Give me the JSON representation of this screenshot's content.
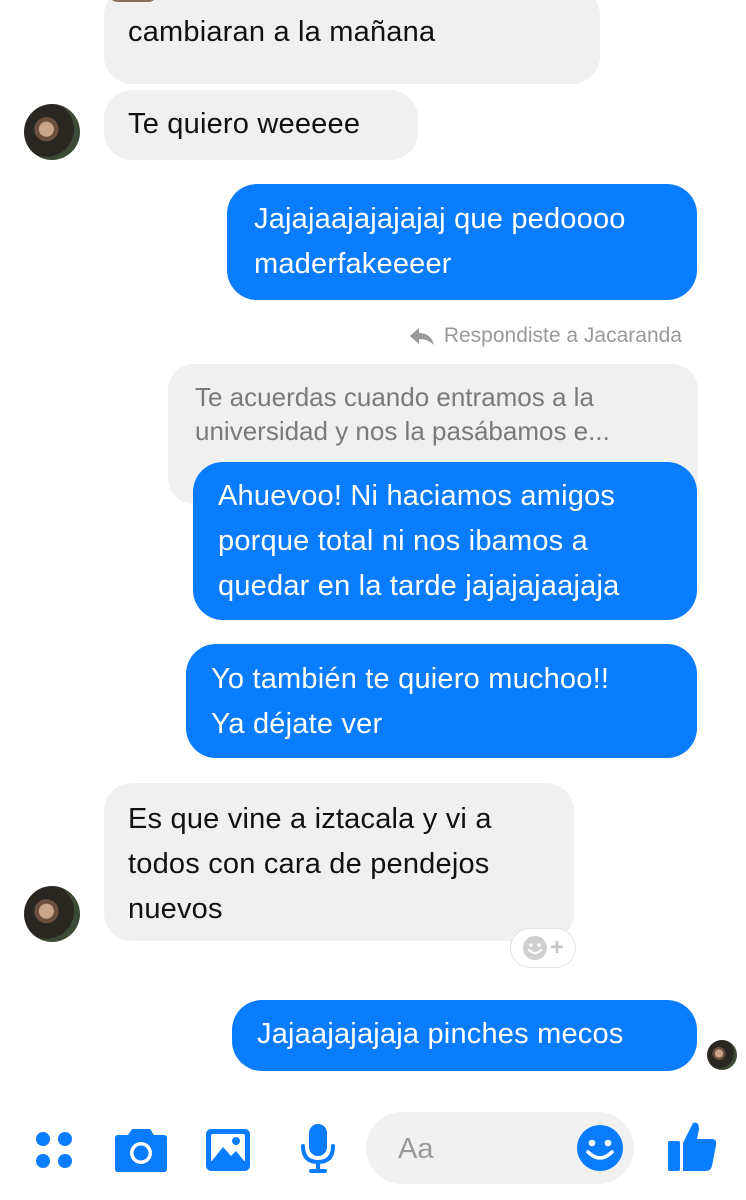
{
  "messages": [
    {
      "id": "m1",
      "direction": "incoming",
      "lines": [
        "cambiaran a la mañana"
      ]
    },
    {
      "id": "m2",
      "direction": "incoming",
      "lines": [
        "Te quiero weeeee"
      ]
    },
    {
      "id": "m3",
      "direction": "outgoing",
      "lines": [
        "Jajajaajajajajaj que pedoooo",
        "maderfakeeeer"
      ]
    },
    {
      "id": "m4",
      "direction": "outgoing",
      "lines": [
        "Ahuevoo! Ni haciamos amigos",
        "porque total ni nos ibamos a",
        "quedar en la tarde jajajajaajaja"
      ]
    },
    {
      "id": "m5",
      "direction": "outgoing",
      "lines": [
        "Yo también te quiero muchoo!!",
        "Ya déjate ver"
      ]
    },
    {
      "id": "m6",
      "direction": "incoming",
      "lines": [
        "Es que vine a iztacala y vi a",
        "todos con cara de pendejos",
        "nuevos"
      ]
    },
    {
      "id": "m7",
      "direction": "outgoing",
      "lines": [
        "Jajaajajajaja pinches mecos"
      ]
    }
  ],
  "reply_context": {
    "label": "Respondiste a Jacaranda",
    "quoted_lines": [
      "Te acuerdas cuando entramos a la",
      "universidad y nos la pasábamos e..."
    ]
  },
  "reaction_button": {
    "icon": "add-reaction-icon",
    "symbol": "+"
  },
  "composer": {
    "placeholder": "Aa"
  },
  "toolbar": {
    "icons": [
      "more-dots-icon",
      "camera-icon",
      "gallery-icon",
      "microphone-icon",
      "emoji-icon",
      "thumbs-up-icon"
    ]
  },
  "colors": {
    "outgoing_bubble": "#0a7cff",
    "incoming_bubble": "#f0f0f0",
    "accent": "#0a7cff"
  }
}
